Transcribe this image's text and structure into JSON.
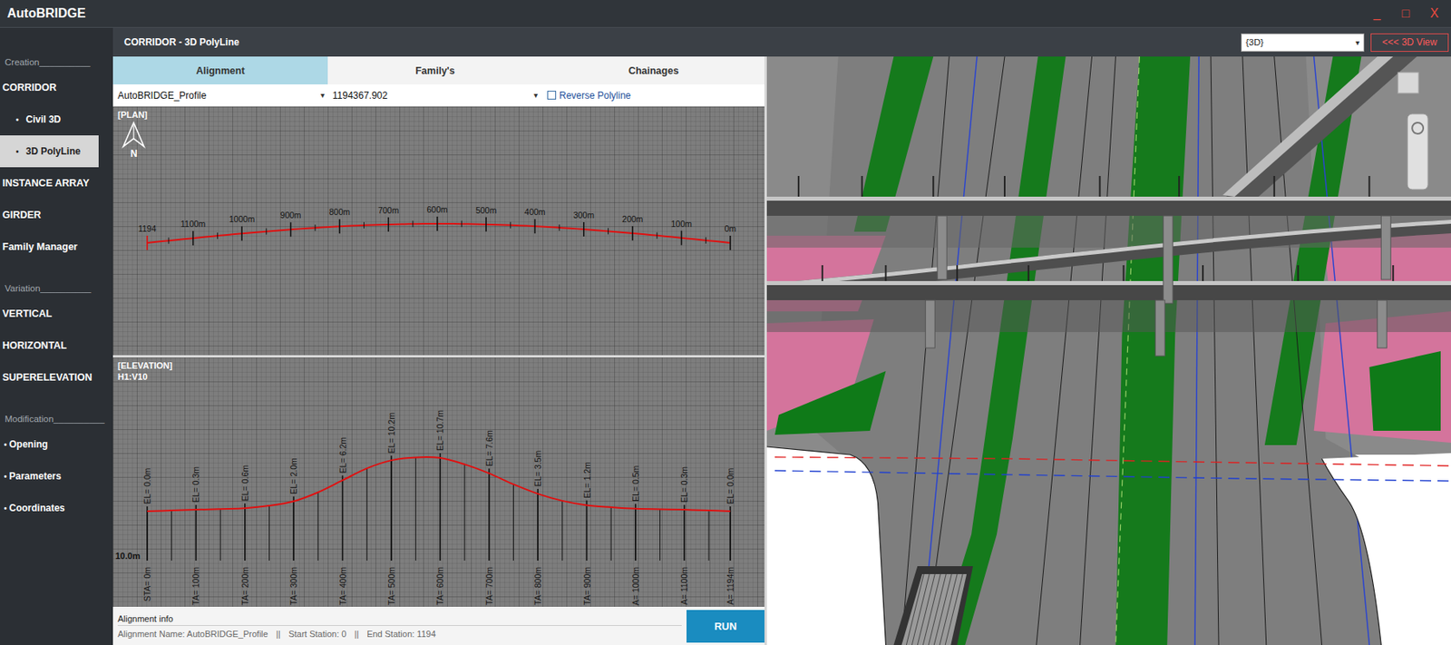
{
  "window": {
    "title": "AutoBRIDGE",
    "controls": [
      {
        "glyph": "_"
      },
      {
        "glyph": "□"
      },
      {
        "glyph": "X"
      }
    ]
  },
  "sidebar": {
    "sections": [
      {
        "label": "Creation__________",
        "items": [
          {
            "label": "CORRIDOR",
            "kind": "main",
            "selected": false
          },
          {
            "label": "Civil 3D",
            "kind": "sub",
            "bullet": "•",
            "selected": false
          },
          {
            "label": "3D PolyLine",
            "kind": "sub",
            "bullet": "•",
            "selected": true
          },
          {
            "label": "INSTANCE ARRAY",
            "kind": "main",
            "selected": false
          },
          {
            "label": "GIRDER",
            "kind": "main",
            "selected": false
          },
          {
            "label": "Family Manager",
            "kind": "main",
            "selected": false
          }
        ]
      },
      {
        "label": "Variation__________",
        "items": [
          {
            "label": "VERTICAL",
            "kind": "main",
            "selected": false
          },
          {
            "label": "HORIZONTAL",
            "kind": "main",
            "selected": false
          },
          {
            "label": "SUPERELEVATION",
            "kind": "main",
            "selected": false
          }
        ]
      },
      {
        "label": "Modification__________",
        "items": [
          {
            "label": "Opening",
            "kind": "tool",
            "bullet": "•",
            "selected": false
          },
          {
            "label": "Parameters",
            "kind": "tool",
            "bullet": "•",
            "selected": false
          },
          {
            "label": "Coordinates",
            "kind": "tool",
            "bullet": "•",
            "selected": false
          }
        ]
      }
    ]
  },
  "header": {
    "title": "CORRIDOR - 3D PolyLine",
    "view_select": {
      "value": "{3D}",
      "arrow": "▾"
    },
    "view_button": "<<< 3D View"
  },
  "tabs": [
    {
      "label": "Alignment",
      "selected": true
    },
    {
      "label": "Family's",
      "selected": false
    },
    {
      "label": "Chainages",
      "selected": false
    }
  ],
  "fields": {
    "alignment": {
      "value": "AutoBRIDGE_Profile",
      "arrow": "▾"
    },
    "length": {
      "value": "1194367.902",
      "arrow": "▾"
    },
    "reverse": {
      "label": "Reverse Polyline",
      "checked": false
    }
  },
  "plan": {
    "label": "[PLAN]",
    "north": "N",
    "length": 1194,
    "stations": [
      {
        "label": "1194",
        "station": 1194
      },
      {
        "label": "1100m",
        "station": 1100
      },
      {
        "label": "1000m",
        "station": 1000
      },
      {
        "label": "900m",
        "station": 900
      },
      {
        "label": "800m",
        "station": 800
      },
      {
        "label": "700m",
        "station": 700
      },
      {
        "label": "600m",
        "station": 600
      },
      {
        "label": "500m",
        "station": 500
      },
      {
        "label": "400m",
        "station": 400
      },
      {
        "label": "300m",
        "station": 300
      },
      {
        "label": "200m",
        "station": 200
      },
      {
        "label": "100m",
        "station": 100
      },
      {
        "label": "0m",
        "station": 0
      }
    ]
  },
  "elevation": {
    "label": "[ELEVATION]",
    "scale": "H1:V10",
    "datum": "10.0m",
    "length": 1194,
    "profile": {
      "stations": [
        0,
        50,
        100,
        150,
        200,
        250,
        300,
        350,
        400,
        450,
        500,
        550,
        600,
        650,
        700,
        750,
        800,
        850,
        900,
        950,
        1000,
        1050,
        1100,
        1150,
        1194
      ],
      "elevations": [
        0,
        0.15,
        0.3,
        0.45,
        0.6,
        1.1,
        2.0,
        3.8,
        6.2,
        8.6,
        10.2,
        10.8,
        10.7,
        9.4,
        7.6,
        5.4,
        3.5,
        2.1,
        1.2,
        0.8,
        0.5,
        0.4,
        0.3,
        0.15,
        0
      ]
    },
    "marks": [
      {
        "station": 0,
        "el_label": "EL= 0.0m",
        "sta_label": "STA= 0m"
      },
      {
        "station": 100,
        "el_label": "EL= 0.3m",
        "sta_label": "TA= 100m"
      },
      {
        "station": 200,
        "el_label": "EL= 0.6m",
        "sta_label": "TA= 200m"
      },
      {
        "station": 300,
        "el_label": "EL= 2.0m",
        "sta_label": "TA= 300m"
      },
      {
        "station": 400,
        "el_label": "EL= 6.2m",
        "sta_label": "TA= 400m"
      },
      {
        "station": 500,
        "el_label": "EL= 10.2m",
        "sta_label": "TA= 500m"
      },
      {
        "station": 600,
        "el_label": "EL= 10.7m",
        "sta_label": "TA= 600m"
      },
      {
        "station": 700,
        "el_label": "EL= 7.6m",
        "sta_label": "TA= 700m"
      },
      {
        "station": 800,
        "el_label": "EL= 3.5m",
        "sta_label": "TA= 800m"
      },
      {
        "station": 900,
        "el_label": "EL= 1.2m",
        "sta_label": "TA= 900m"
      },
      {
        "station": 1000,
        "el_label": "EL= 0.5m",
        "sta_label": "A= 1000m"
      },
      {
        "station": 1100,
        "el_label": "EL= 0.3m",
        "sta_label": "A= 1100m"
      },
      {
        "station": 1194,
        "el_label": "EL= 0.0m",
        "sta_label": "A= 1194m"
      }
    ]
  },
  "footer": {
    "title": "Alignment info",
    "items": [
      "Alignment Name: AutoBRIDGE_Profile",
      "Start Station: 0",
      "End Station: 1194"
    ],
    "separator": "||",
    "run": "RUN"
  }
}
